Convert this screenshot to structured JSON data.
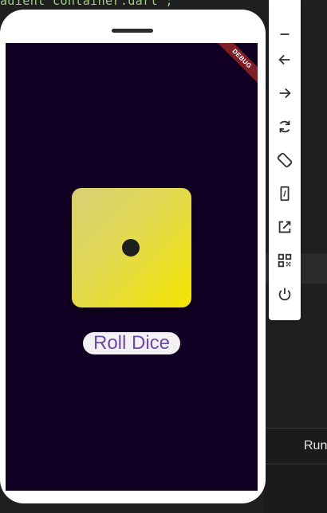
{
  "editor": {
    "code_line": "adient container.dart';"
  },
  "ide": {
    "run_label": "Run"
  },
  "device": {
    "debug_banner": "DEBUG"
  },
  "app": {
    "dice_value": 1,
    "roll_button_label": "Roll Dice"
  },
  "toolbar": {
    "items": [
      {
        "name": "minimize-icon"
      },
      {
        "name": "back-icon"
      },
      {
        "name": "forward-icon"
      },
      {
        "name": "rotate-icon"
      },
      {
        "name": "screen-rotation-icon"
      },
      {
        "name": "phone-portrait-icon"
      },
      {
        "name": "open-external-icon"
      },
      {
        "name": "qr-code-icon"
      },
      {
        "name": "power-icon"
      }
    ]
  },
  "colors": {
    "screen_bg": "#120024",
    "dice_gradient_start": "#d8cf77",
    "dice_gradient_end": "#f4e600",
    "button_text": "#6e4aa8",
    "debug_banner": "#7d1f27"
  }
}
